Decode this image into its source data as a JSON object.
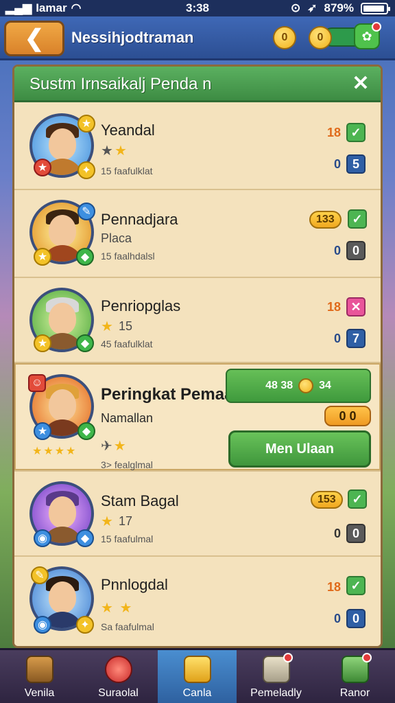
{
  "status_bar": {
    "carrier": "Iamar",
    "time": "3:38",
    "battery": "879%"
  },
  "header": {
    "title": "Nessihjodtraman",
    "coin1": "0",
    "coin2": "0"
  },
  "panel": {
    "title": "Sustm Irnsaikalj Penda n",
    "close_label": "✕"
  },
  "players": [
    {
      "name": "Yeandal",
      "sub": "",
      "stats": "15 faafulklat",
      "score": "18",
      "score2": "0",
      "check1": "✓",
      "check2": "5"
    },
    {
      "name": "Pennadjara",
      "sub": "Placa",
      "stats": "15 faalhdalsl",
      "score": "133",
      "score2": "0",
      "check1": "✓",
      "check2": "0"
    },
    {
      "name": "Penriopglas",
      "sub": "15",
      "stats": "45 faafulklat",
      "score": "18",
      "score2": "0",
      "check1": "✕",
      "check2": "7"
    },
    {
      "name": "Peringkat Pemaan.",
      "sub": "Namallan",
      "stats": "3> fealglmal",
      "reward_text": "48 38",
      "reward_value": "34",
      "small_pill": "0 0",
      "action_label": "Men Ulaan"
    },
    {
      "name": "Stam Bagal",
      "sub": "17",
      "stats": "15 faafulmal",
      "score": "153",
      "score2": "0",
      "check1": "✓",
      "check2": "0"
    },
    {
      "name": "Pnnlogdal",
      "sub": "",
      "stats": "Sa faafulmal",
      "score": "18",
      "score2": "0",
      "check1": "✓",
      "check2": "0"
    }
  ],
  "nav": [
    {
      "label": "Venila"
    },
    {
      "label": "Suraolal"
    },
    {
      "label": "Canla"
    },
    {
      "label": "Pemeladly"
    },
    {
      "label": "Ranor"
    }
  ]
}
